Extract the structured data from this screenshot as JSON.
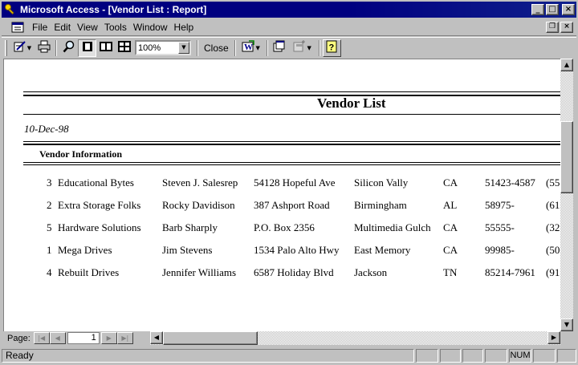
{
  "window": {
    "title": "Microsoft Access - [Vendor List : Report]",
    "buttons": {
      "minimize": "_",
      "maximize": "□",
      "close": "×"
    }
  },
  "menu": {
    "items": [
      "File",
      "Edit",
      "View",
      "Tools",
      "Window",
      "Help"
    ],
    "restore_symbol": "❐",
    "close_symbol": "×"
  },
  "toolbar": {
    "zoom_value": "100%",
    "close_label": "Close"
  },
  "report": {
    "title": "Vendor List",
    "date": "10-Dec-98",
    "section_header": "Vendor Information",
    "rows": [
      [
        "3",
        "Educational Bytes",
        "Steven J. Salesrep",
        "54128 Hopeful Ave",
        "Silicon Vally",
        "CA",
        "51423-4587",
        "(55"
      ],
      [
        "2",
        "Extra Storage Folks",
        "Rocky Davidison",
        "387 Ashport Road",
        "Birmingham",
        "AL",
        "58975-",
        "(61"
      ],
      [
        "5",
        "Hardware Solutions",
        "Barb Sharply",
        "P.O. Box 2356",
        "Multimedia Gulch",
        "CA",
        "55555-",
        "(32"
      ],
      [
        "1",
        "Mega Drives",
        "Jim Stevens",
        "1534 Palo Alto Hwy",
        "East Memory",
        "CA",
        "99985-",
        "(50"
      ],
      [
        "4",
        "Rebuilt Drives",
        "Jennifer Williams",
        "6587 Holiday Blvd",
        "Jackson",
        "TN",
        "85214-7961",
        "(91"
      ]
    ]
  },
  "navigation": {
    "page_label": "Page:",
    "page_number": "1"
  },
  "status": {
    "text": "Ready",
    "num_indicator": "NUM"
  }
}
